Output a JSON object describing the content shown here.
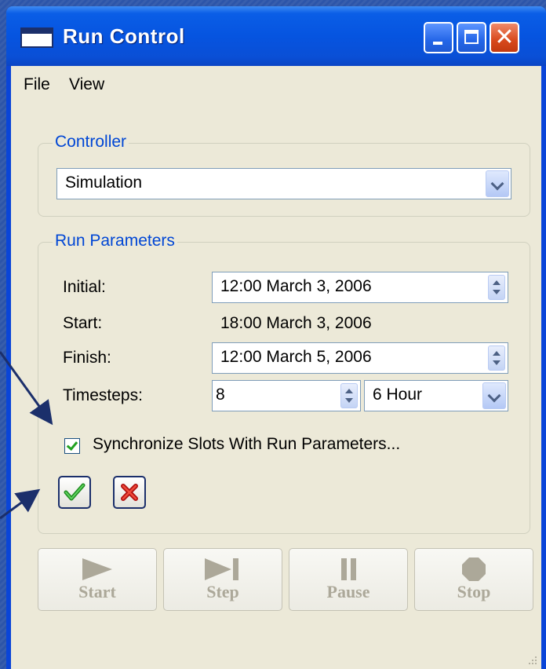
{
  "window": {
    "title": "Run Control"
  },
  "menu": {
    "items": [
      "File",
      "View"
    ]
  },
  "controller": {
    "group_label": "Controller",
    "selected": "Simulation"
  },
  "run_parameters": {
    "group_label": "Run Parameters",
    "initial_label": "Initial:",
    "initial_value": "12:00 March 3, 2006",
    "start_label": "Start:",
    "start_value": "18:00 March 3, 2006",
    "finish_label": "Finish:",
    "finish_value": "12:00 March 5, 2006",
    "timesteps_label": "Timesteps:",
    "timesteps_value": "8",
    "timestep_unit": "6 Hour",
    "sync_label": "Synchronize Slots With Run Parameters...",
    "sync_checked": true
  },
  "controls": {
    "start": "Start",
    "step": "Step",
    "pause": "Pause",
    "stop": "Stop"
  },
  "colors": {
    "titlebar": "#0a5ee6",
    "group_label": "#0046d5",
    "disabled_text": "#aca899"
  }
}
